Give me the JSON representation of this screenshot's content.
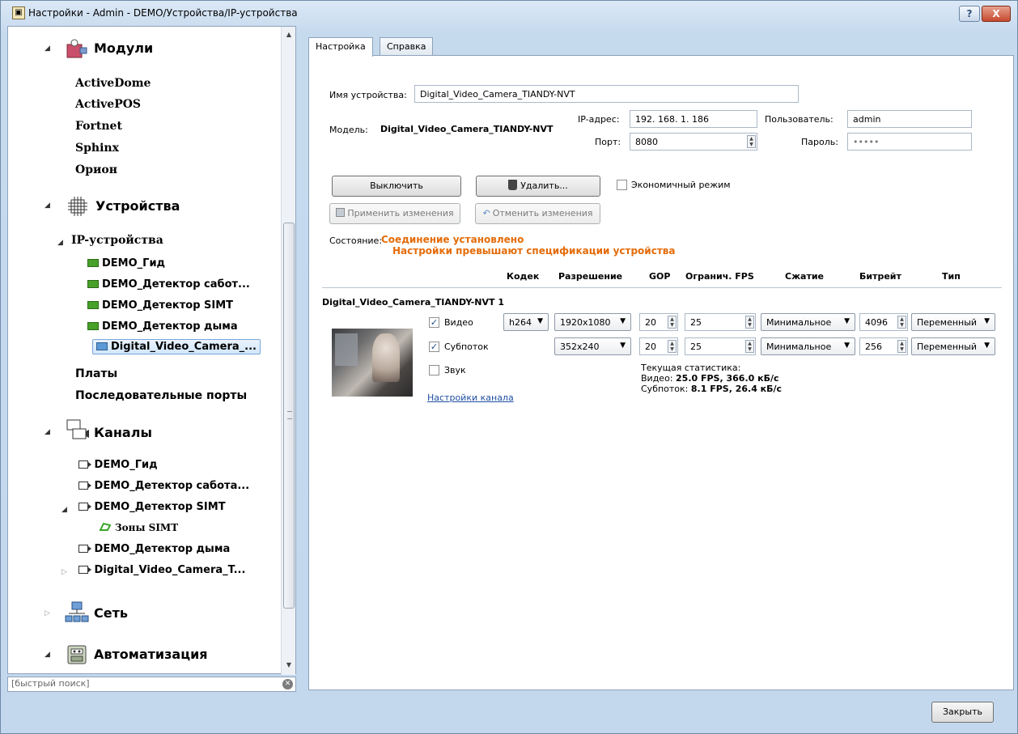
{
  "window": {
    "title": "Настройки - Admin - DEMO/Устройства/IP-устройства",
    "help_label": "?",
    "close_label": "X"
  },
  "tree": {
    "modules": {
      "label": "Модули",
      "children": [
        "ActiveDome",
        "ActivePOS",
        "Fortnet",
        "Sphinx",
        "Орион"
      ]
    },
    "devices": {
      "label": "Устройства",
      "ip_devices": {
        "label": "IP-устройства",
        "children": [
          "DEMO_Гид",
          "DEMO_Детектор сабот...",
          "DEMO_Детектор SIMT",
          "DEMO_Детектор дыма",
          "Digital_Video_Camera_..."
        ]
      },
      "boards": "Платы",
      "serial_ports": "Последовательные порты"
    },
    "channels": {
      "label": "Каналы",
      "children": [
        "DEMO_Гид",
        "DEMO_Детектор сабота...",
        "DEMO_Детектор SIMT",
        "DEMO_Детектор дыма",
        "Digital_Video_Camera_T..."
      ],
      "simt_zone": "Зоны SIMT"
    },
    "network": "Сеть",
    "automation": "Автоматизация"
  },
  "search": {
    "placeholder": "[быстрый поиск]"
  },
  "tabs": [
    {
      "label": "Настройка",
      "active": true
    },
    {
      "label": "Справка",
      "active": false
    }
  ],
  "device": {
    "name_label": "Имя устройства:",
    "name_value": "Digital_Video_Camera_TIANDY-NVT",
    "model_label": "Модель:",
    "model_value": "Digital_Video_Camera_TIANDY-NVT",
    "ip_label": "IP-адрес:",
    "ip_value": "192. 168. 1. 186",
    "port_label": "Порт:",
    "port_value": "8080",
    "user_label": "Пользователь:",
    "user_value": "admin",
    "password_label": "Пароль:",
    "password_value": "•••••"
  },
  "actions": {
    "disable": "Выключить",
    "delete": "Удалить...",
    "eco_mode": "Экономичный режим",
    "apply": "Применить изменения",
    "cancel": "Отменить изменения"
  },
  "status": {
    "label": "Состояние:",
    "line1": "Соединение установлено",
    "line2": "Настройки превышают спецификации устройства"
  },
  "stream_table": {
    "headers": [
      "Кодек",
      "Разрешение",
      "GOP",
      "Огранич. FPS",
      "Сжатие",
      "Битрейт",
      "Тип"
    ],
    "camera_title": "Digital_Video_Camera_TIANDY-NVT 1",
    "video": {
      "label": "Видео",
      "codec": "h264",
      "resolution": "1920x1080",
      "gop": "20",
      "fps": "25",
      "compression": "Минимальное",
      "bitrate": "4096",
      "type": "Переменный"
    },
    "substream": {
      "label": "Субпоток",
      "resolution": "352x240",
      "gop": "20",
      "fps": "25",
      "compression": "Минимальное",
      "bitrate": "256",
      "type": "Переменный"
    },
    "audio": {
      "label": "Звук"
    },
    "channel_settings_link": "Настройки канала",
    "stats": {
      "title": "Текущая статистика:",
      "video_label": "Видео:",
      "video_value": "25.0 FPS, 366.0 кБ/с",
      "sub_label": "Субпоток:",
      "sub_value": "8.1 FPS, 26.4 кБ/с"
    }
  },
  "footer": {
    "close": "Закрыть"
  }
}
